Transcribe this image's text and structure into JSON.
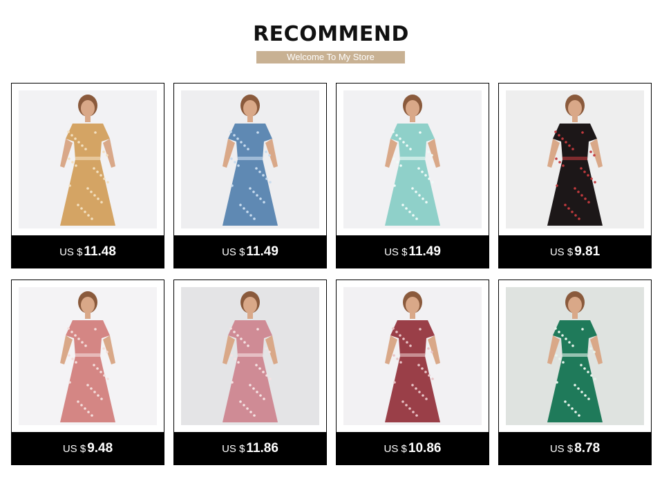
{
  "header": {
    "title": "RECOMMEND",
    "subtitle": "Welcome To My Store"
  },
  "products": [
    {
      "currency": "US $",
      "price": "11.48",
      "image": "dress-mustard-wrap-maxi",
      "dress_color": "#d4a464",
      "pattern_color": "#f3e0c0",
      "bg_color": "#f2f2f4"
    },
    {
      "currency": "US $",
      "price": "11.49",
      "image": "dress-blue-floral-maxi",
      "dress_color": "#5f89b3",
      "pattern_color": "#c9dcef",
      "bg_color": "#eeeef0"
    },
    {
      "currency": "US $",
      "price": "11.49",
      "image": "dress-mint-ruffle-maxi",
      "dress_color": "#8fd0c9",
      "pattern_color": "#f0fbf8",
      "bg_color": "#f1f1f3"
    },
    {
      "currency": "US $",
      "price": "9.81",
      "image": "dress-black-rose-midi",
      "dress_color": "#1c1718",
      "pattern_color": "#c23a3e",
      "bg_color": "#eeeeee"
    },
    {
      "currency": "US $",
      "price": "9.48",
      "image": "dress-pink-ruffle-mini",
      "dress_color": "#d48684",
      "pattern_color": "#f4dedc",
      "bg_color": "#f4f3f5"
    },
    {
      "currency": "US $",
      "price": "11.86",
      "image": "dress-rose-floral-tiered",
      "dress_color": "#cf8b95",
      "pattern_color": "#f5e3e4",
      "bg_color": "#e4e4e6"
    },
    {
      "currency": "US $",
      "price": "10.86",
      "image": "dress-burgundy-print-midi",
      "dress_color": "#9a3f48",
      "pattern_color": "#e8c4c7",
      "bg_color": "#f2f1f3"
    },
    {
      "currency": "US $",
      "price": "8.78",
      "image": "dress-green-floral-mini",
      "dress_color": "#1f7a5a",
      "pattern_color": "#e8f4ec",
      "bg_color": "#dfe3e0"
    }
  ]
}
